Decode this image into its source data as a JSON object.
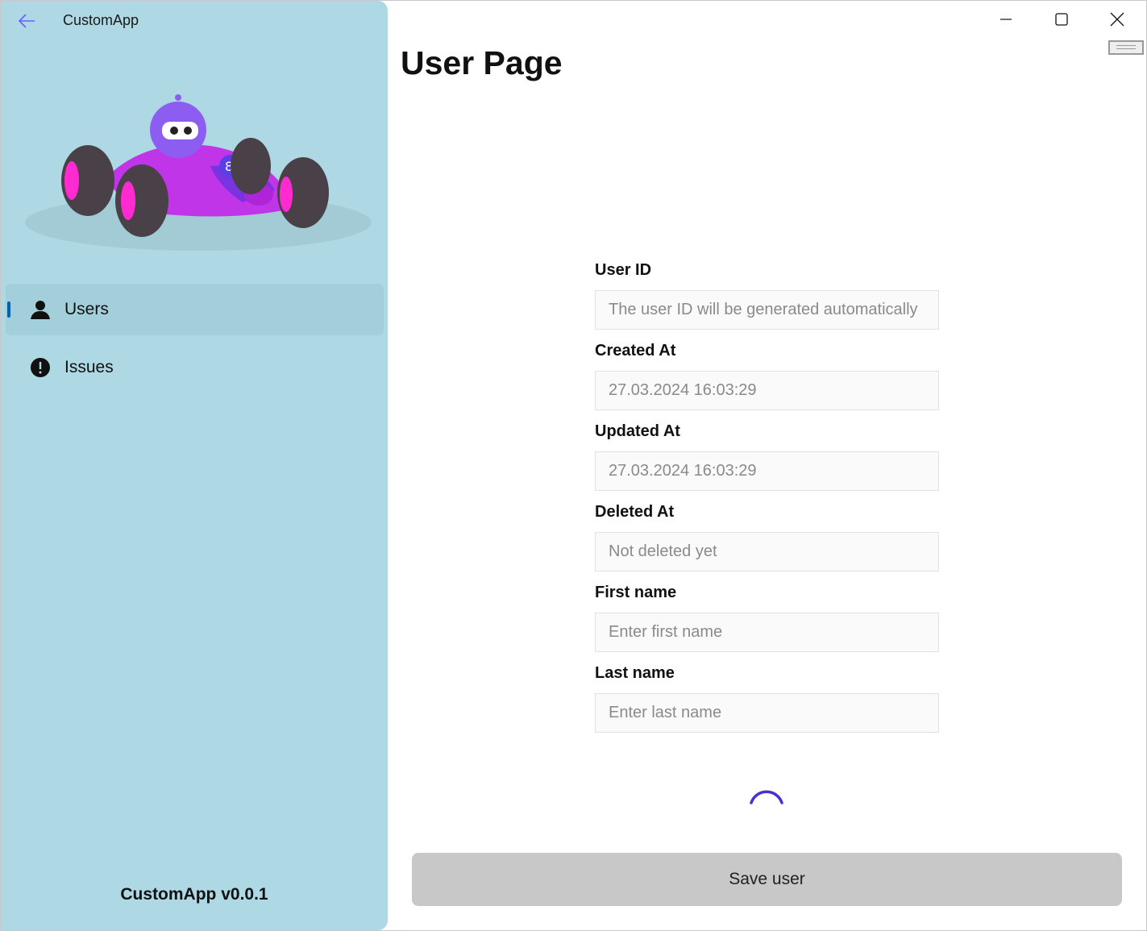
{
  "app": {
    "title": "CustomApp",
    "version": "CustomApp v0.0.1"
  },
  "window": {
    "minimize_icon": "minimize-icon",
    "maximize_icon": "maximize-icon",
    "close_icon": "close-icon"
  },
  "nav": {
    "items": [
      {
        "label": "Users",
        "icon": "person-icon",
        "selected": true
      },
      {
        "label": "Issues",
        "icon": "exclamation-circle-icon",
        "selected": false
      }
    ],
    "accent": "#005fb8"
  },
  "page": {
    "title": "User Page"
  },
  "form": {
    "fields": [
      {
        "label": "User ID",
        "value": "",
        "placeholder": "The user ID will be generated automatically"
      },
      {
        "label": "Created At",
        "value": "27.03.2024 16:03:29",
        "placeholder": ""
      },
      {
        "label": "Updated At",
        "value": "27.03.2024 16:03:29",
        "placeholder": ""
      },
      {
        "label": "Deleted At",
        "value": "",
        "placeholder": "Not deleted yet"
      },
      {
        "label": "First name",
        "value": "",
        "placeholder": "Enter first name"
      },
      {
        "label": "Last name",
        "value": "",
        "placeholder": "Enter last name"
      }
    ],
    "save_label": "Save user"
  },
  "colors": {
    "sidebar": "#add8e4",
    "spinner": "#4b2fd6",
    "back_arrow": "#6a5cff"
  }
}
